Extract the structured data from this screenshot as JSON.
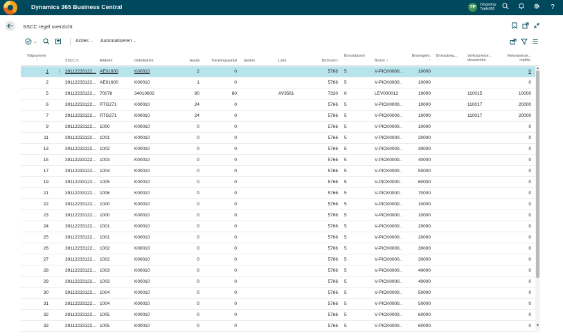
{
  "app": {
    "title": "Dynamics 365 Business Central",
    "env_line1": "Omgeving:",
    "env_line2": "Trade365",
    "env_initials": "TP"
  },
  "page": {
    "title": "SSCC regel overzicht"
  },
  "actions": {
    "acties": "Acties",
    "automatiseren": "Automatiseren"
  },
  "columns": [
    "Volgnummer",
    "SSCC nr.",
    "Artikelnr.",
    "Orderklantnr.",
    "Aantal",
    "Traceringsaantal",
    "Serienr.",
    "Lotnr.",
    "Bronsoort",
    "Bronsubsoort",
    "Bronnr.",
    "Bronregelnr.",
    "Bronsubreg...",
    "Verkoopverze... documentnr.",
    "Verkoopverze... regelnr."
  ],
  "rows": [
    {
      "volg": "1",
      "sscc": "39112233122...",
      "art": "AE01600",
      "klant": "K00010",
      "aantal": "2",
      "trac": "0",
      "lot": "",
      "bsoort": "5766",
      "bsub": "5",
      "bronnr": "V-PICK0000...",
      "bregel": "10000",
      "vdoc": "",
      "vregel": "0"
    },
    {
      "volg": "2",
      "sscc": "39112233122...",
      "art": "AE01600",
      "klant": "K00010",
      "aantal": "1",
      "trac": "0",
      "lot": "",
      "bsoort": "5766",
      "bsub": "5",
      "bronnr": "V-PICK0000...",
      "bregel": "10000",
      "vdoc": "",
      "vregel": "0"
    },
    {
      "volg": "5",
      "sscc": "39112233122...",
      "art": "70078",
      "klant": "34010602",
      "aantal": "80",
      "trac": "80",
      "lot": "AV3561",
      "bsoort": "7320",
      "bsub": "0",
      "bronnr": "LEV000012",
      "bregel": "10000",
      "vdoc": "110015",
      "vregel": "10000"
    },
    {
      "volg": "6",
      "sscc": "39112233122...",
      "art": "RTG271",
      "klant": "K00010",
      "aantal": "24",
      "trac": "0",
      "lot": "",
      "bsoort": "5766",
      "bsub": "5",
      "bronnr": "V-PICK0000...",
      "bregel": "10000",
      "vdoc": "110017",
      "vregel": "20000"
    },
    {
      "volg": "7",
      "sscc": "39112233122...",
      "art": "RTG271",
      "klant": "K00010",
      "aantal": "24",
      "trac": "0",
      "lot": "",
      "bsoort": "5766",
      "bsub": "5",
      "bronnr": "V-PICK0000...",
      "bregel": "10000",
      "vdoc": "110017",
      "vregel": "20000"
    },
    {
      "volg": "9",
      "sscc": "39112233122...",
      "art": "1000",
      "klant": "K00010",
      "aantal": "0",
      "trac": "0",
      "lot": "",
      "bsoort": "5766",
      "bsub": "5",
      "bronnr": "V-PICK0000...",
      "bregel": "10000",
      "vdoc": "",
      "vregel": "0"
    },
    {
      "volg": "11",
      "sscc": "39112233122...",
      "art": "1001",
      "klant": "K00010",
      "aantal": "0",
      "trac": "0",
      "lot": "",
      "bsoort": "5766",
      "bsub": "5",
      "bronnr": "V-PICK0000...",
      "bregel": "20000",
      "vdoc": "",
      "vregel": "0"
    },
    {
      "volg": "13",
      "sscc": "39112233122...",
      "art": "1002",
      "klant": "K00010",
      "aantal": "0",
      "trac": "0",
      "lot": "",
      "bsoort": "5766",
      "bsub": "5",
      "bronnr": "V-PICK0000...",
      "bregel": "30000",
      "vdoc": "",
      "vregel": "0"
    },
    {
      "volg": "15",
      "sscc": "39112233122...",
      "art": "1003",
      "klant": "K00010",
      "aantal": "0",
      "trac": "0",
      "lot": "",
      "bsoort": "5766",
      "bsub": "5",
      "bronnr": "V-PICK0000...",
      "bregel": "40000",
      "vdoc": "",
      "vregel": "0"
    },
    {
      "volg": "17",
      "sscc": "39112233122...",
      "art": "1004",
      "klant": "K00010",
      "aantal": "0",
      "trac": "0",
      "lot": "",
      "bsoort": "5766",
      "bsub": "5",
      "bronnr": "V-PICK0000...",
      "bregel": "50000",
      "vdoc": "",
      "vregel": "0"
    },
    {
      "volg": "19",
      "sscc": "39112233122...",
      "art": "1005",
      "klant": "K00010",
      "aantal": "0",
      "trac": "0",
      "lot": "",
      "bsoort": "5766",
      "bsub": "5",
      "bronnr": "V-PICK0000...",
      "bregel": "60000",
      "vdoc": "",
      "vregel": "0"
    },
    {
      "volg": "21",
      "sscc": "39112233122...",
      "art": "1006",
      "klant": "K00010",
      "aantal": "0",
      "trac": "0",
      "lot": "",
      "bsoort": "5766",
      "bsub": "5",
      "bronnr": "V-PICK0000...",
      "bregel": "70000",
      "vdoc": "",
      "vregel": "0"
    },
    {
      "volg": "22",
      "sscc": "39112233122...",
      "art": "1000",
      "klant": "K00010",
      "aantal": "0",
      "trac": "0",
      "lot": "",
      "bsoort": "5766",
      "bsub": "5",
      "bronnr": "V-PICK0000...",
      "bregel": "10000",
      "vdoc": "",
      "vregel": "0"
    },
    {
      "volg": "23",
      "sscc": "39112233122...",
      "art": "1000",
      "klant": "K00010",
      "aantal": "0",
      "trac": "0",
      "lot": "",
      "bsoort": "5766",
      "bsub": "5",
      "bronnr": "V-PICK0000...",
      "bregel": "10000",
      "vdoc": "",
      "vregel": "0"
    },
    {
      "volg": "24",
      "sscc": "39112233122...",
      "art": "1001",
      "klant": "K00010",
      "aantal": "0",
      "trac": "0",
      "lot": "",
      "bsoort": "5766",
      "bsub": "5",
      "bronnr": "V-PICK0000...",
      "bregel": "20000",
      "vdoc": "",
      "vregel": "0"
    },
    {
      "volg": "25",
      "sscc": "39112233122...",
      "art": "1001",
      "klant": "K00010",
      "aantal": "0",
      "trac": "0",
      "lot": "",
      "bsoort": "5766",
      "bsub": "5",
      "bronnr": "V-PICK0000...",
      "bregel": "20000",
      "vdoc": "",
      "vregel": "0"
    },
    {
      "volg": "26",
      "sscc": "39112233122...",
      "art": "1002",
      "klant": "K00010",
      "aantal": "0",
      "trac": "0",
      "lot": "",
      "bsoort": "5766",
      "bsub": "5",
      "bronnr": "V-PICK0000...",
      "bregel": "30000",
      "vdoc": "",
      "vregel": "0"
    },
    {
      "volg": "27",
      "sscc": "39112233122...",
      "art": "1002",
      "klant": "K00010",
      "aantal": "0",
      "trac": "0",
      "lot": "",
      "bsoort": "5766",
      "bsub": "5",
      "bronnr": "V-PICK0000...",
      "bregel": "30000",
      "vdoc": "",
      "vregel": "0"
    },
    {
      "volg": "28",
      "sscc": "39112233122...",
      "art": "1003",
      "klant": "K00010",
      "aantal": "0",
      "trac": "0",
      "lot": "",
      "bsoort": "5766",
      "bsub": "5",
      "bronnr": "V-PICK0000...",
      "bregel": "40000",
      "vdoc": "",
      "vregel": "0"
    },
    {
      "volg": "29",
      "sscc": "39112233122...",
      "art": "1003",
      "klant": "K00010",
      "aantal": "0",
      "trac": "0",
      "lot": "",
      "bsoort": "5766",
      "bsub": "5",
      "bronnr": "V-PICK0000...",
      "bregel": "40000",
      "vdoc": "",
      "vregel": "0"
    },
    {
      "volg": "30",
      "sscc": "39112233122...",
      "art": "1004",
      "klant": "K00010",
      "aantal": "0",
      "trac": "0",
      "lot": "",
      "bsoort": "5766",
      "bsub": "5",
      "bronnr": "V-PICK0000...",
      "bregel": "50000",
      "vdoc": "",
      "vregel": "0"
    },
    {
      "volg": "31",
      "sscc": "39112233122...",
      "art": "1004",
      "klant": "K00010",
      "aantal": "0",
      "trac": "0",
      "lot": "",
      "bsoort": "5766",
      "bsub": "5",
      "bronnr": "V-PICK0000...",
      "bregel": "50000",
      "vdoc": "",
      "vregel": "0"
    },
    {
      "volg": "32",
      "sscc": "39112233122...",
      "art": "1005",
      "klant": "K00010",
      "aantal": "0",
      "trac": "0",
      "lot": "",
      "bsoort": "5766",
      "bsub": "5",
      "bronnr": "V-PICK0000...",
      "bregel": "60000",
      "vdoc": "",
      "vregel": "0"
    },
    {
      "volg": "33",
      "sscc": "39112233122...",
      "art": "1005",
      "klant": "K00010",
      "aantal": "0",
      "trac": "0",
      "lot": "",
      "bsoort": "5766",
      "bsub": "5",
      "bronnr": "V-PICK0000...",
      "bregel": "60000",
      "vdoc": "",
      "vregel": "0"
    }
  ],
  "icons": {
    "back": "arrow-left-icon",
    "search": "search-icon",
    "bell": "bell-icon",
    "settings": "gear-icon",
    "help": "help-icon",
    "bookmark": "bookmark-icon",
    "open_new": "open-new-window-icon",
    "collapse": "collapse-icon",
    "share": "share-icon",
    "filter": "filter-icon",
    "list": "list-icon"
  },
  "colors": {
    "topbar": "#00485b",
    "selected_row": "#b7e4ec",
    "accent": "#00485b"
  }
}
